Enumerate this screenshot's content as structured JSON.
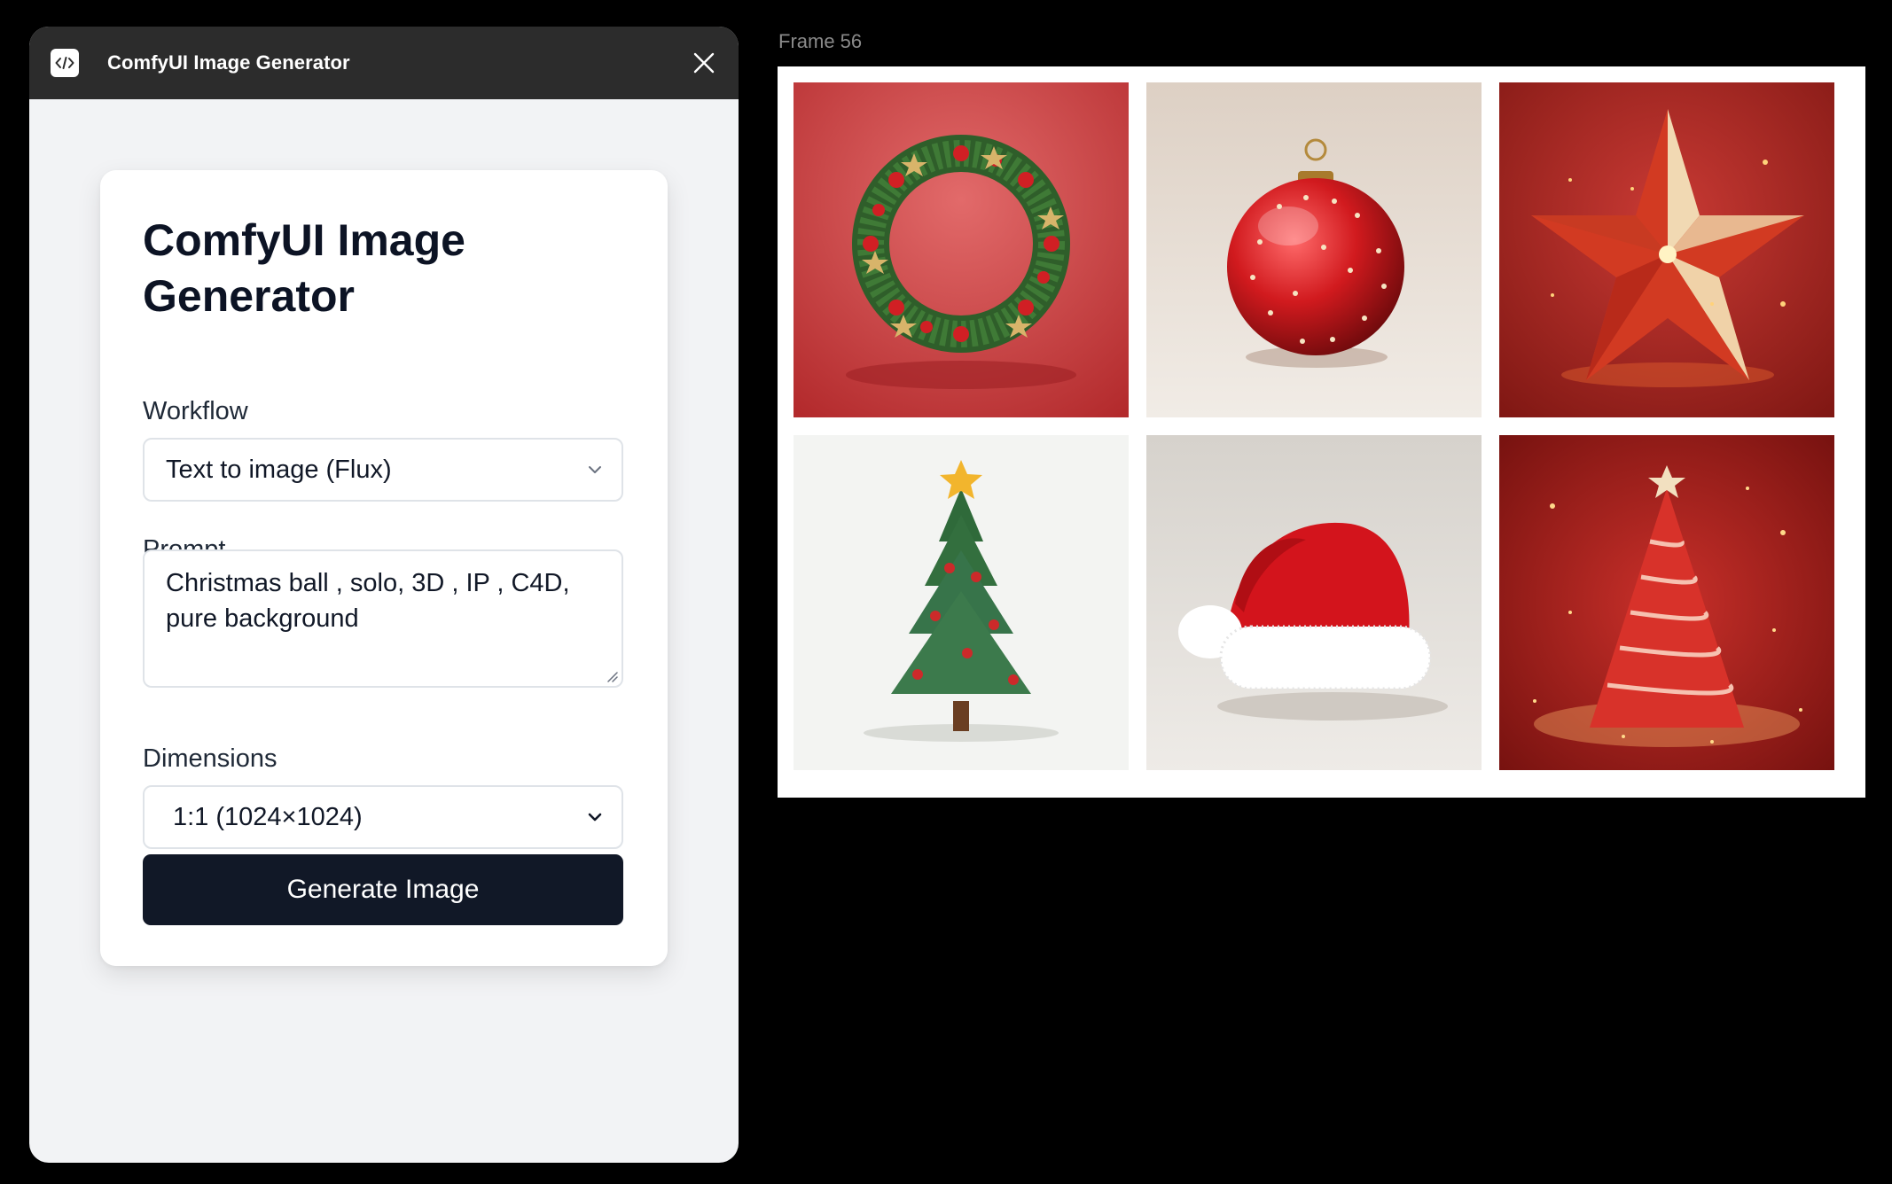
{
  "plugin": {
    "title": "ComfyUI Image Generator",
    "icon": "code-brackets-icon",
    "close_icon": "close-icon"
  },
  "form": {
    "heading": "ComfyUI Image Generator",
    "workflow_label": "Workflow",
    "workflow_value": "Text to image (Flux)",
    "prompt_label": "Prompt",
    "prompt_value": "Christmas ball , solo, 3D , IP , C4D, pure background",
    "dimensions_label": "Dimensions",
    "dimensions_value": "1:1 (1024×1024)",
    "generate_label": "Generate Image"
  },
  "frame": {
    "label": "Frame 56",
    "images": [
      {
        "subject": "christmas-wreath"
      },
      {
        "subject": "christmas-ball-ornament"
      },
      {
        "subject": "christmas-star"
      },
      {
        "subject": "christmas-tree"
      },
      {
        "subject": "santa-hat"
      },
      {
        "subject": "sparkling-christmas-tree"
      }
    ]
  },
  "colors": {
    "titlebar": "#2c2c2c",
    "panel_bg": "#f2f3f5",
    "button_bg": "#111827",
    "canvas_bg": "#000000"
  }
}
